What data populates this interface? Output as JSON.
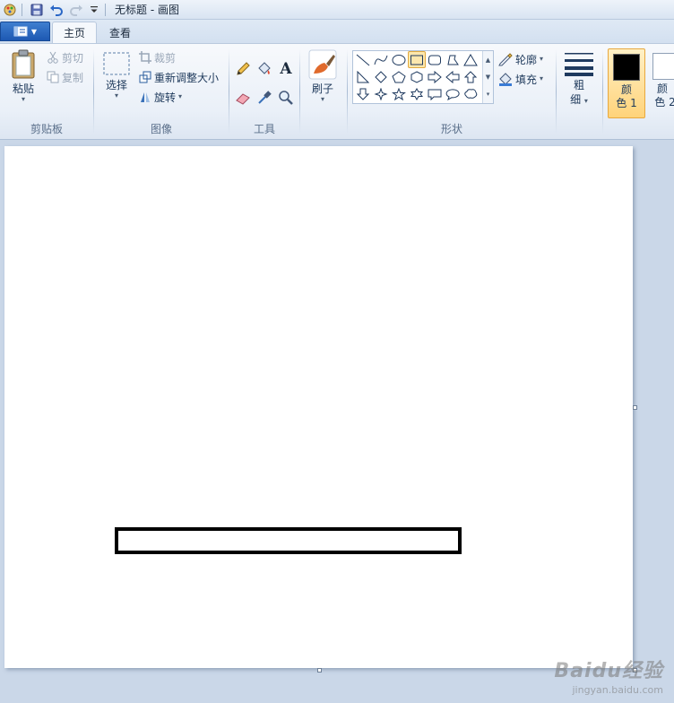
{
  "window": {
    "title": "无标题 - 画图"
  },
  "tabs": [
    {
      "label": "主页",
      "active": true
    },
    {
      "label": "查看",
      "active": false
    }
  ],
  "ribbon": {
    "clipboard": {
      "group_label": "剪贴板",
      "paste_label": "粘贴",
      "cut_label": "剪切",
      "copy_label": "复制"
    },
    "image": {
      "group_label": "图像",
      "select_label": "选择",
      "crop_label": "裁剪",
      "resize_label": "重新调整大小",
      "rotate_label": "旋转"
    },
    "tools": {
      "group_label": "工具",
      "text_tool_glyph": "A"
    },
    "brushes": {
      "label": "刷子"
    },
    "shapes": {
      "group_label": "形状",
      "outline_label": "轮廓",
      "fill_label": "填充",
      "selected_shape": "rectangle"
    },
    "size": {
      "label_line1": "粗",
      "label_line2": "细"
    },
    "colors": {
      "color1_line1": "颜",
      "color1_line2": "色 1",
      "color1_value": "#000000",
      "color2_line1": "颜",
      "color2_line2": "色 2",
      "color2_value": "#ffffff"
    }
  },
  "canvas": {
    "background": "#ffffff",
    "shape_stroke": "#000000"
  },
  "watermark": {
    "main": "Baidu经验",
    "sub": "jingyan.baidu.com"
  }
}
